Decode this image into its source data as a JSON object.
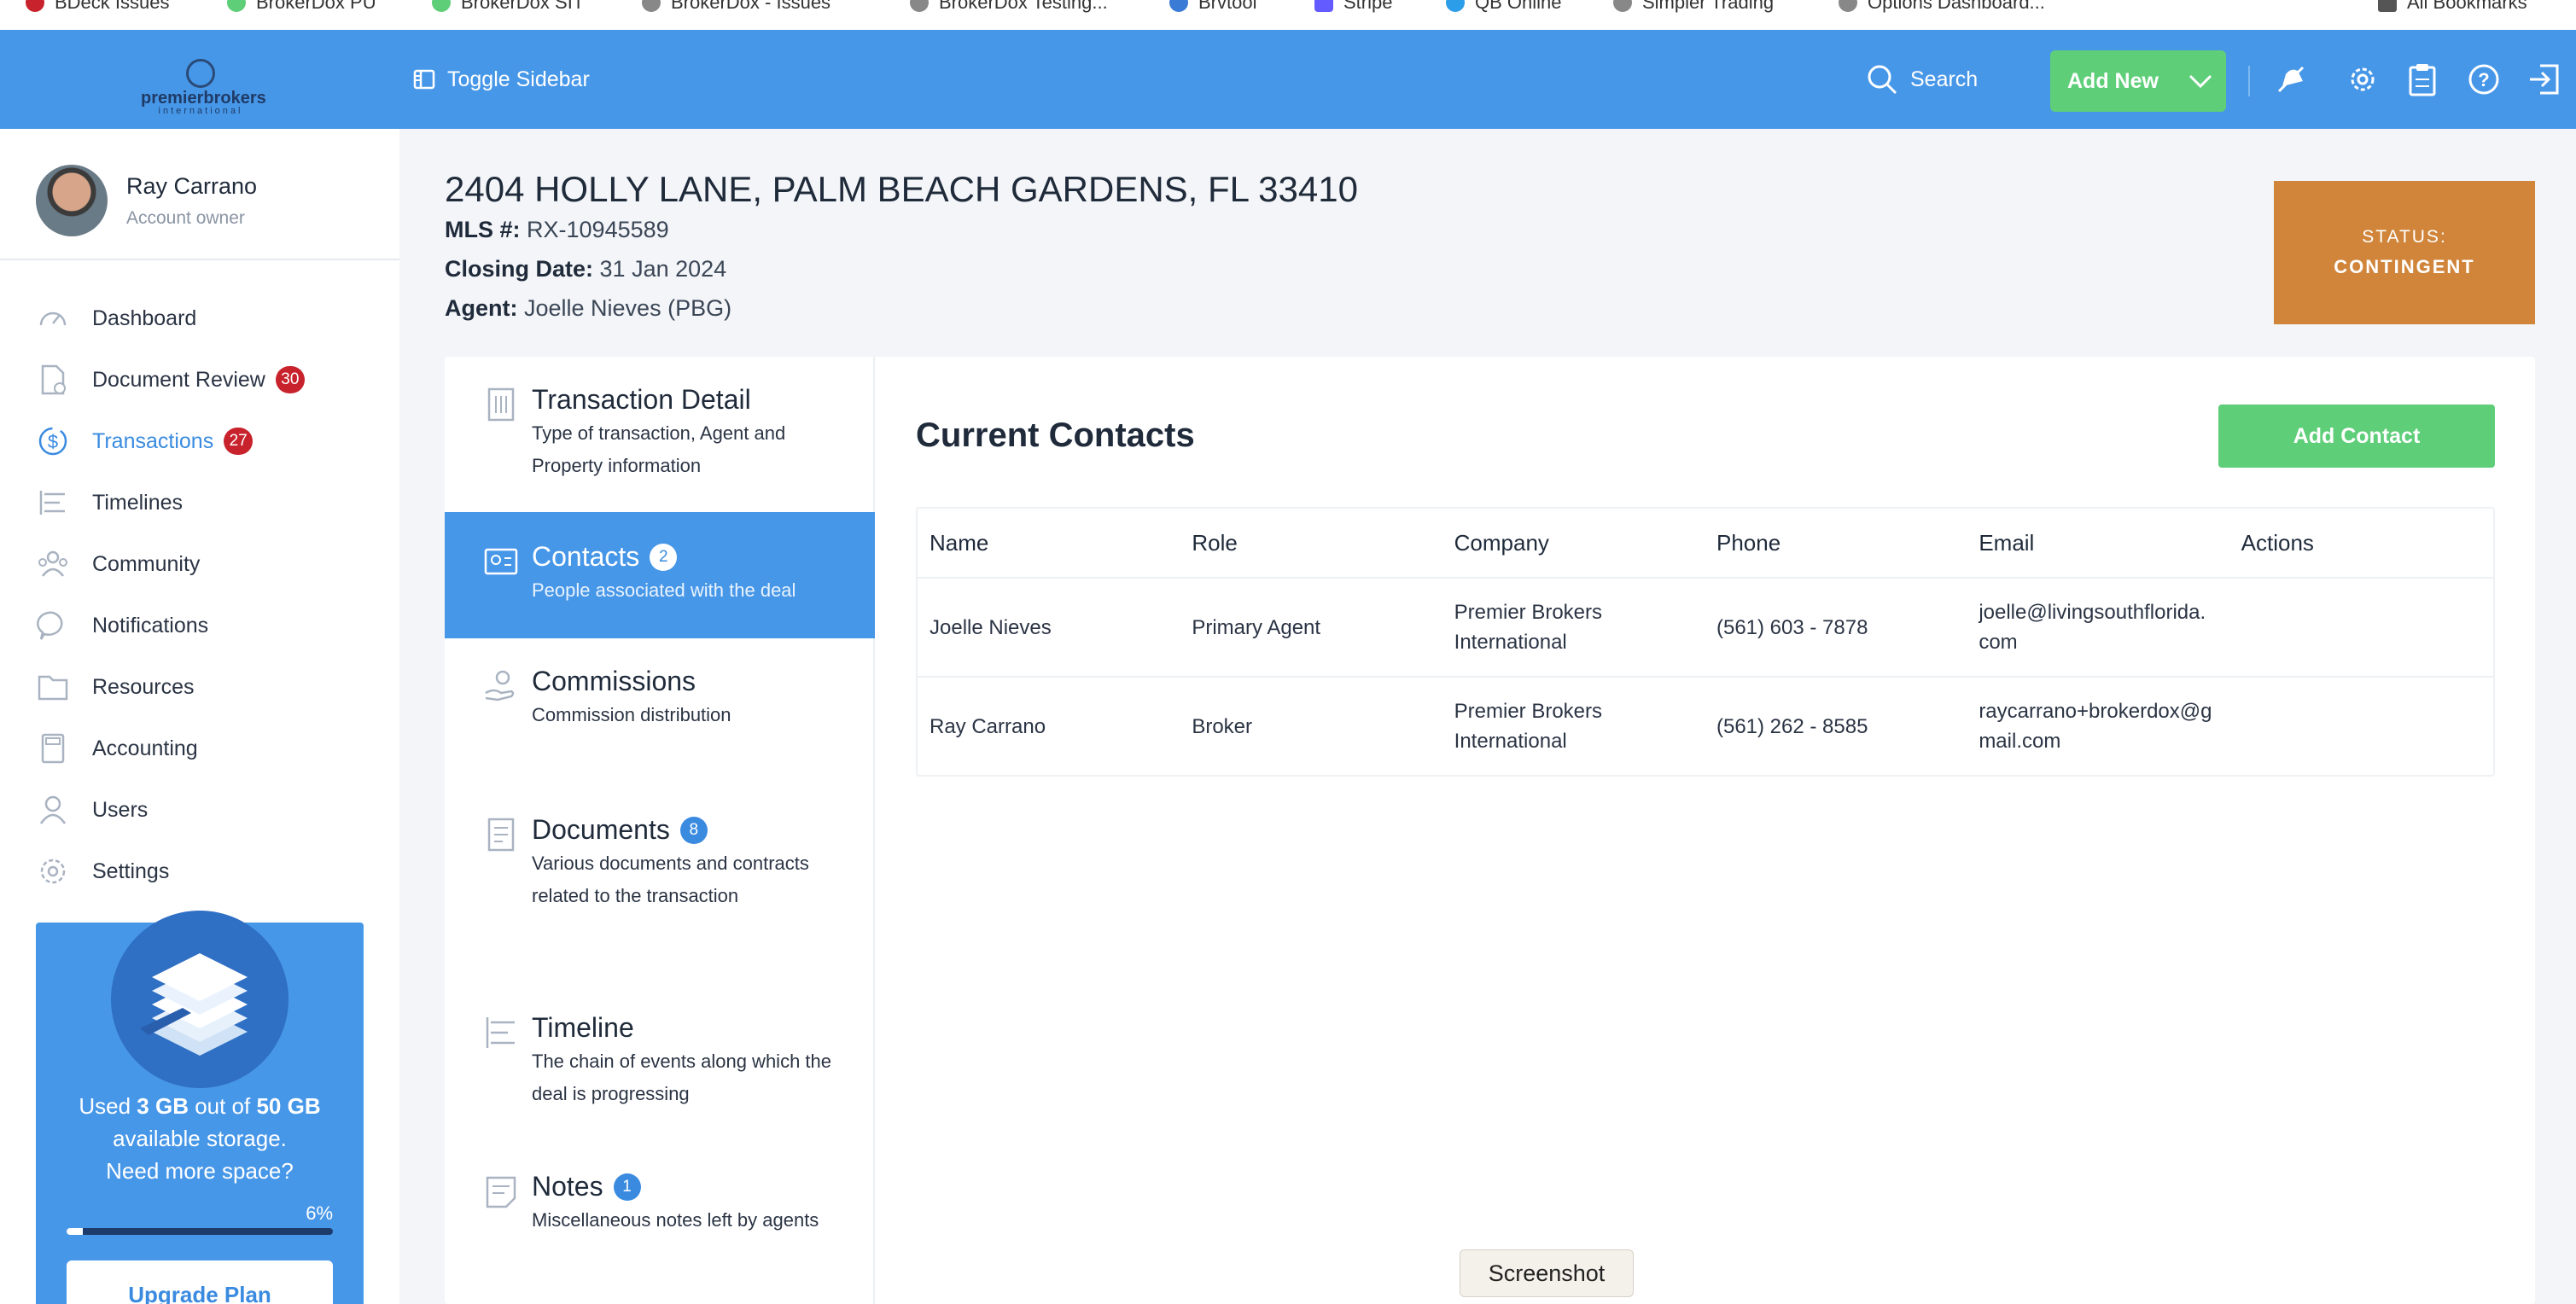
{
  "bookmarks": [
    "BDeck Issues",
    "BrokerDox PU",
    "BrokerDox SIT",
    "BrokerDox - Issues",
    "BrokerDox Testing...",
    "Brvtool",
    "Stripe",
    "QB Online",
    "Simpler Trading",
    "Options Dashboard...",
    "All Bookmarks"
  ],
  "topbar": {
    "logo_text": "premierbrokers",
    "logo_sub": "international",
    "toggle_label": "Toggle Sidebar",
    "search_label": "Search",
    "add_new_label": "Add New",
    "icons": [
      "bell-off-icon",
      "gear-icon",
      "clipboard-icon",
      "help-icon",
      "logout-icon"
    ]
  },
  "profile": {
    "name": "Ray Carrano",
    "role": "Account owner"
  },
  "nav": [
    {
      "label": "Dashboard",
      "icon": "dashboard-icon"
    },
    {
      "label": "Document Review",
      "icon": "document-check-icon",
      "badge": "30"
    },
    {
      "label": "Transactions",
      "icon": "dollar-cycle-icon",
      "badge": "27",
      "active": true
    },
    {
      "label": "Timelines",
      "icon": "timeline-icon"
    },
    {
      "label": "Community",
      "icon": "community-icon"
    },
    {
      "label": "Notifications",
      "icon": "chat-icon"
    },
    {
      "label": "Resources",
      "icon": "folder-icon"
    },
    {
      "label": "Accounting",
      "icon": "calculator-icon"
    },
    {
      "label": "Users",
      "icon": "user-icon"
    },
    {
      "label": "Settings",
      "icon": "gear-icon"
    }
  ],
  "storage": {
    "text_used": "Used ",
    "used": "3 GB",
    "text_out": " out of ",
    "total": "50 GB",
    "line2": "available storage.",
    "line3": "Need more space?",
    "percent_label": "6%",
    "percent": 6,
    "upgrade_label": "Upgrade Plan"
  },
  "property": {
    "address": "2404 HOLLY LANE, PALM BEACH GARDENS, FL 33410",
    "mls_label": "MLS #:",
    "mls": "RX-10945589",
    "closing_label": "Closing Date:",
    "closing": "31 Jan 2024",
    "agent_label": "Agent:",
    "agent": "Joelle Nieves (PBG)",
    "status_label": "STATUS:",
    "status": "CONTINGENT",
    "status_color": "#d1853b"
  },
  "steps": [
    {
      "title": "Transaction Detail",
      "desc": "Type of transaction, Agent and Property information",
      "icon": "building-icon"
    },
    {
      "title": "Contacts",
      "count": "2",
      "desc": "People associated with the deal",
      "icon": "contact-card-icon",
      "active": true
    },
    {
      "title": "Commissions",
      "desc": "Commission distribution",
      "icon": "hand-coin-icon"
    },
    {
      "title": "Documents",
      "count": "8",
      "desc": "Various documents and contracts related to the transaction",
      "icon": "document-icon"
    },
    {
      "title": "Timeline",
      "desc": "The chain of events along which the deal is progressing",
      "icon": "timeline-icon"
    },
    {
      "title": "Notes",
      "count": "1",
      "desc": "Miscellaneous notes left by agents",
      "icon": "notes-icon"
    }
  ],
  "contacts": {
    "title": "Current Contacts",
    "add_label": "Add Contact",
    "columns": [
      "Name",
      "Role",
      "Company",
      "Phone",
      "Email",
      "Actions"
    ],
    "rows": [
      {
        "name": "Joelle Nieves",
        "role": "Primary Agent",
        "company": "Premier Brokers International",
        "phone": "(561) 603 - 7878",
        "email": "joelle@livingsouthflorida.com",
        "actions": ""
      },
      {
        "name": "Ray Carrano",
        "role": "Broker",
        "company": "Premier Brokers International",
        "phone": "(561) 262 - 8585",
        "email": "raycarrano+brokerdox@gmail.com",
        "actions": ""
      }
    ]
  },
  "tooltip": "Screenshot",
  "colors": {
    "primary": "#4797e8",
    "green": "#5fce79",
    "badge_red": "#c8232c",
    "status_orange": "#d1853b"
  }
}
